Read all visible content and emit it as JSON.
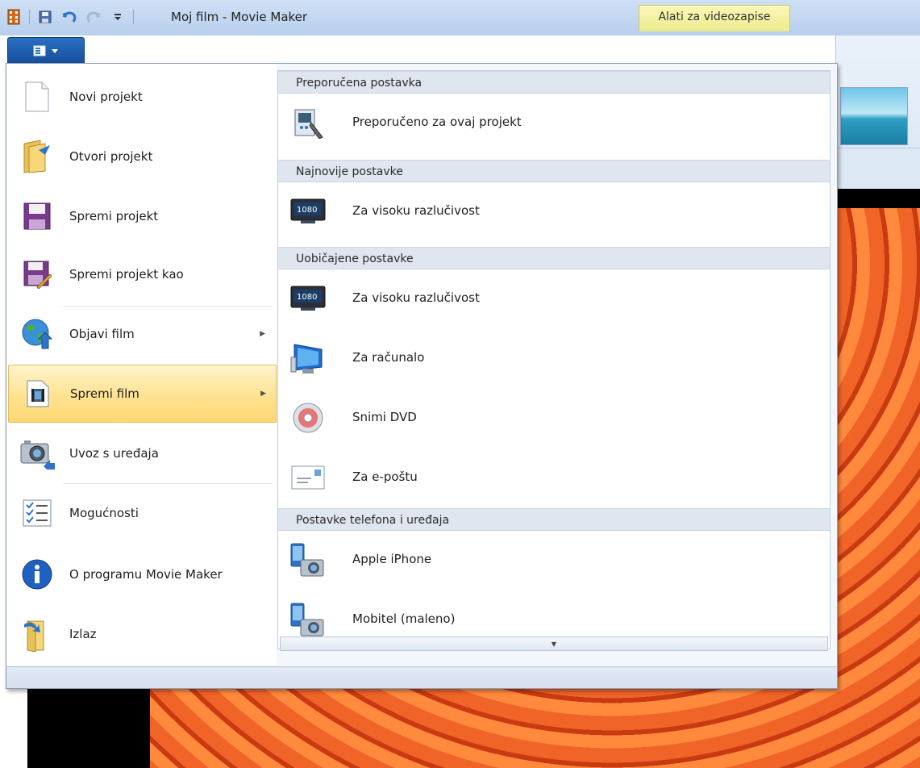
{
  "window": {
    "title": "Moj film - Movie Maker",
    "context_tab": "Alati za videozapise"
  },
  "app_menu": {
    "items": [
      {
        "label": "Novi projekt",
        "icon": "new-document-icon"
      },
      {
        "label": "Otvori projekt",
        "icon": "open-folder-icon"
      },
      {
        "label": "Spremi projekt",
        "icon": "save-disk-icon"
      },
      {
        "label": "Spremi projekt kao",
        "icon": "save-as-icon"
      },
      {
        "label": "Objavi film",
        "icon": "publish-globe-icon",
        "has_submenu": true
      },
      {
        "label": "Spremi film",
        "icon": "save-movie-icon",
        "has_submenu": true,
        "highlighted": true
      },
      {
        "label": "Uvoz s uređaja",
        "icon": "import-camera-icon"
      },
      {
        "label": "Mogućnosti",
        "icon": "options-checklist-icon"
      },
      {
        "label": "O programu Movie Maker",
        "icon": "info-icon"
      },
      {
        "label": "Izlaz",
        "icon": "exit-icon"
      }
    ]
  },
  "submenu": {
    "sections": [
      {
        "header": "Preporučena postavka",
        "items": [
          {
            "label": "Preporučeno za ovaj projekt",
            "icon": "recommended-settings-icon"
          }
        ]
      },
      {
        "header": "Najnovije postavke",
        "items": [
          {
            "label": "Za visoku razlučivost",
            "icon": "hd-1080-icon"
          }
        ]
      },
      {
        "header": "Uobičajene postavke",
        "items": [
          {
            "label": "Za visoku razlučivost",
            "icon": "hd-1080-icon"
          },
          {
            "label": "Za računalo",
            "icon": "computer-monitor-icon"
          },
          {
            "label": "Snimi DVD",
            "icon": "dvd-disc-icon"
          },
          {
            "label": "Za e-poštu",
            "icon": "email-envelope-icon"
          }
        ]
      },
      {
        "header": "Postavke telefona i uređaja",
        "items": [
          {
            "label": "Apple iPhone",
            "icon": "phone-device-icon"
          },
          {
            "label": "Mobitel (maleno)",
            "icon": "phone-device-icon"
          }
        ]
      }
    ]
  }
}
